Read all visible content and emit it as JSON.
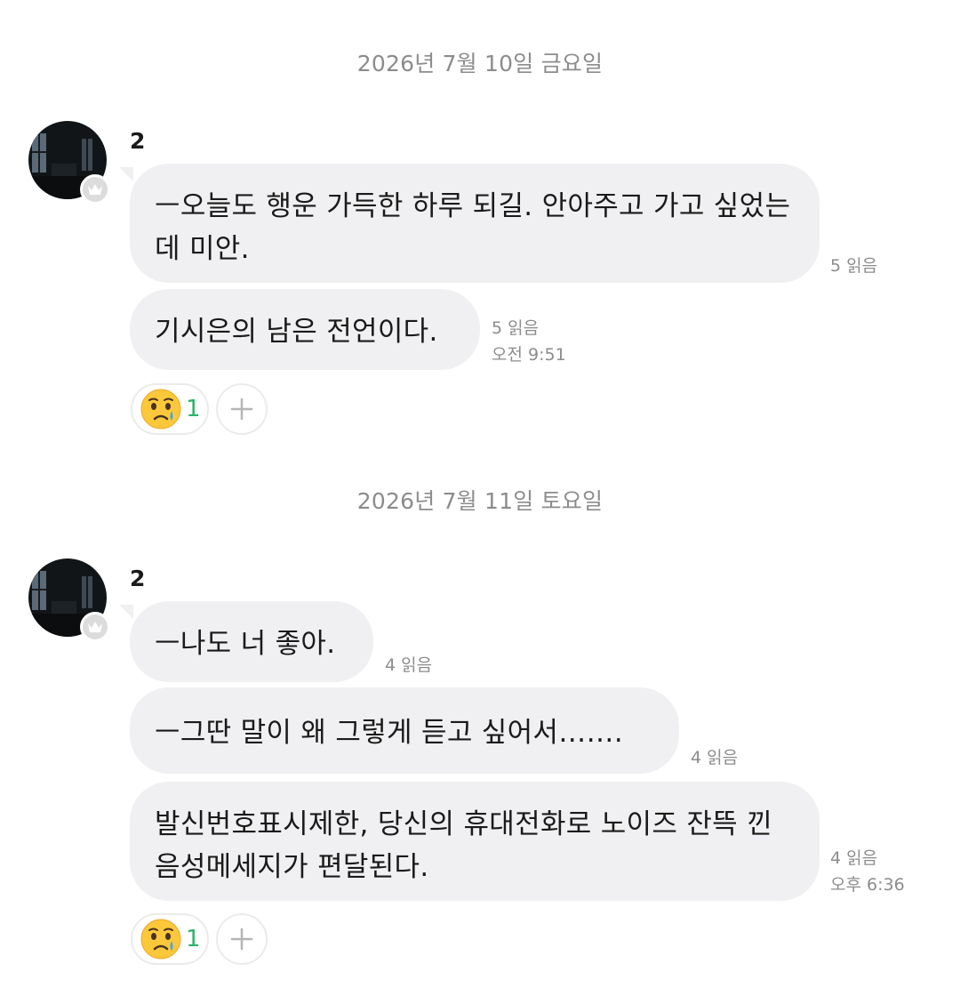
{
  "days": [
    {
      "date": "2026년 7월 10일 금요일",
      "sender": "2",
      "messages": [
        {
          "text": "ㅡ오늘도 행운 가득한 하루 되길. 안아주고 가고 싶었는데 미안.",
          "read": "5 읽음",
          "time": ""
        },
        {
          "text": "기시은의 남은 전언이다.",
          "read": "5 읽음",
          "time": "오전 9:51"
        }
      ],
      "reaction": {
        "emoji": "crying-face",
        "count": "1"
      }
    },
    {
      "date": "2026년 7월 11일 토요일",
      "sender": "2",
      "messages": [
        {
          "text": "ㅡ나도 너 좋아.",
          "read": "4 읽음",
          "time": ""
        },
        {
          "text": "ㅡ그딴 말이 왜 그렇게 듣고 싶어서…….",
          "read": "4 읽음",
          "time": ""
        },
        {
          "text": "발신번호표시제한, 당신의 휴대전화로 노이즈 잔뜩 낀 음성메세지가 편달된다.",
          "read": "4 읽음",
          "time": "오후 6:36"
        }
      ],
      "reaction": {
        "emoji": "crying-face",
        "count": "1"
      }
    }
  ],
  "colors": {
    "bubble": "#f0f0f2",
    "meta_text": "#8c8c8c",
    "reaction_count": "#2fb36a"
  }
}
